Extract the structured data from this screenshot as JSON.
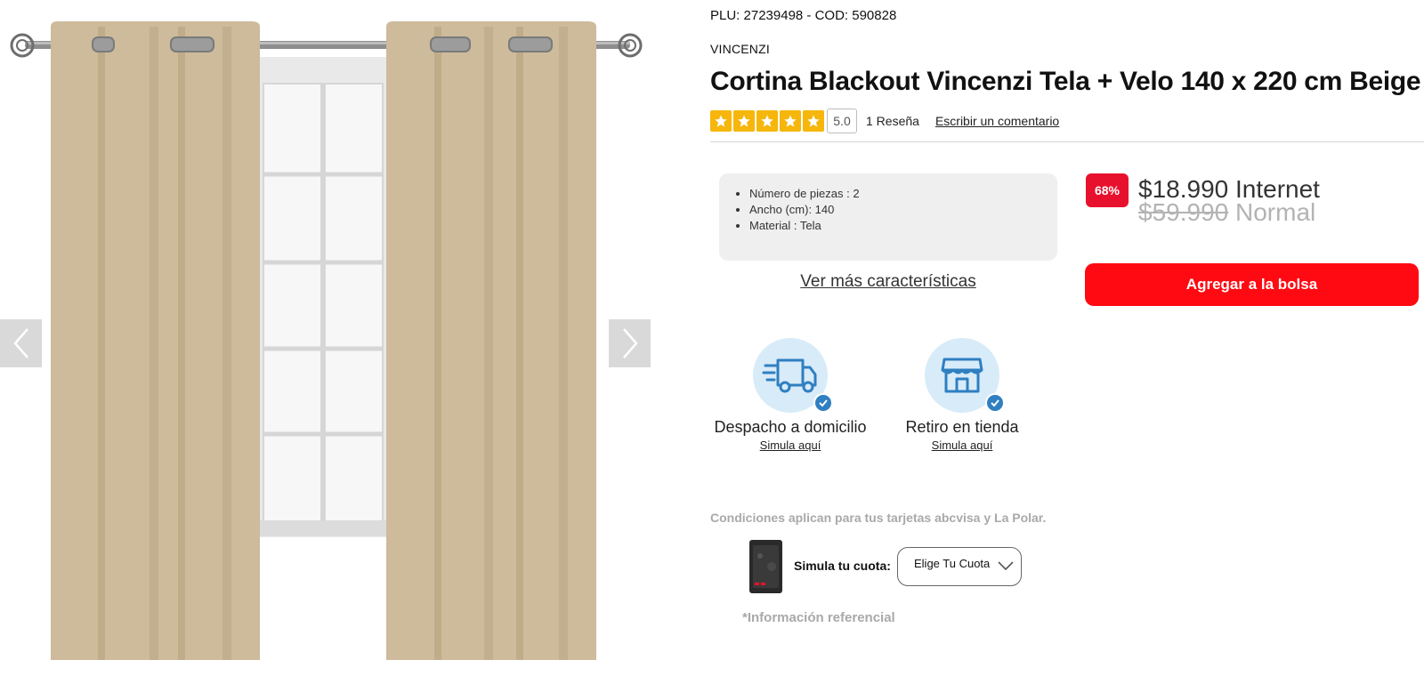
{
  "gallery": {
    "image_alt": "Cortina beige con ojetillos colgada en barra metálica frente a una ventana",
    "prev_icon": "chevron-left-icon",
    "next_icon": "chevron-right-icon"
  },
  "product": {
    "plu_line": "PLU: 27239498 - COD: 590828",
    "brand": "VINCENZI",
    "title": "Cortina Blackout Vincenzi Tela + Velo 140 x 220 cm Beige",
    "rating_value": "5.0",
    "rating_stars": 5,
    "review_count": "1 Reseña",
    "write_review": "Escribir un comentario",
    "features": [
      "Número de piezas : 2",
      "Ancho (cm): 140",
      "Material : Tela"
    ],
    "more_features": "Ver más características"
  },
  "pricing": {
    "discount": "68%",
    "internet_price": "$18.990",
    "internet_label": "Internet",
    "normal_price": "$59.990",
    "normal_label": "Normal",
    "add_to_bag": "Agregar a la bolsa"
  },
  "services": {
    "delivery": {
      "label": "Despacho a domicilio",
      "link": "Simula aquí",
      "icon": "delivery-truck-icon"
    },
    "store": {
      "label": "Retiro en tienda",
      "link": "Simula aquí",
      "icon": "store-icon"
    }
  },
  "installments": {
    "conditions": "Condiciones aplican para tus tarjetas abcvisa y La Polar.",
    "simula_label": "Simula tu cuota:",
    "select_value": "Elige Tu Cuota",
    "footnote": "*Información referencial"
  },
  "colors": {
    "accent_red": "#ff0a12",
    "badge_red": "#e8112d",
    "star_yellow": "#f6b60b",
    "service_blue": "#2f7fc1",
    "curtain_beige": "#cdbb9b"
  }
}
